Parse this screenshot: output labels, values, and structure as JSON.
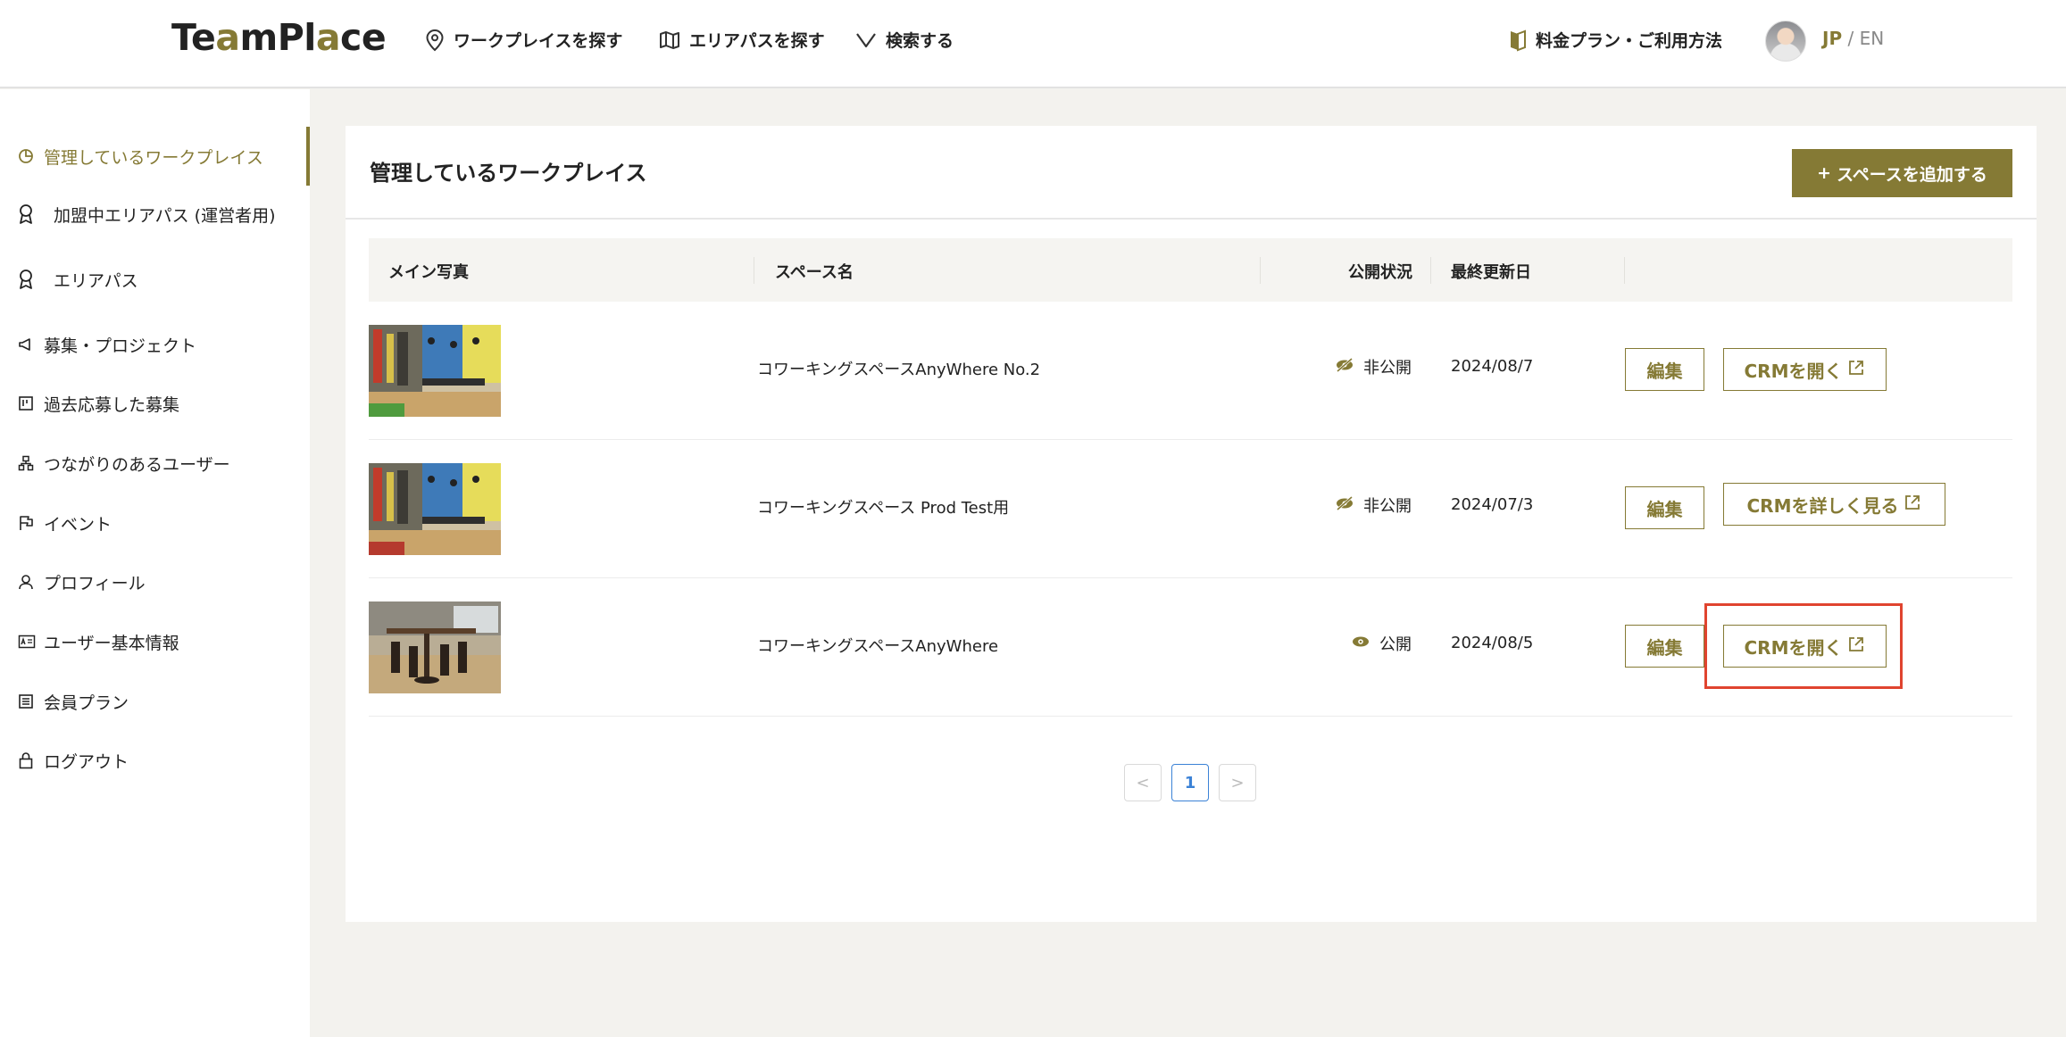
{
  "header": {
    "logo": {
      "prefix": "Te",
      "accent": "a",
      "middle": "mPl",
      "accent2": "a",
      "suffix": "ce"
    },
    "nav": [
      {
        "label": "ワークプレイスを探す",
        "icon": "map-pin-icon"
      },
      {
        "label": "エリアパスを探す",
        "icon": "map-icon"
      },
      {
        "label": "検索する",
        "icon": "chevron-down-icon"
      }
    ],
    "pricing": {
      "label": "料金プラン・ご利用方法",
      "icon": "book-icon"
    },
    "lang": {
      "jp": "JP",
      "sep": " / ",
      "en": "EN"
    }
  },
  "sidebar": {
    "items": [
      {
        "label": "管理しているワークプレイス",
        "icon": "pie-chart-icon",
        "active": true
      },
      {
        "label": "加盟中エリアパス (運営者用)",
        "icon": "award-icon"
      },
      {
        "label": "エリアパス",
        "icon": "award-icon"
      },
      {
        "label": "募集・プロジェクト",
        "icon": "megaphone-icon"
      },
      {
        "label": "過去応募した募集",
        "icon": "board-icon"
      },
      {
        "label": "つながりのあるユーザー",
        "icon": "network-icon"
      },
      {
        "label": "イベント",
        "icon": "flag-icon"
      },
      {
        "label": "プロフィール",
        "icon": "user-icon"
      },
      {
        "label": "ユーザー基本情報",
        "icon": "id-card-icon"
      },
      {
        "label": "会員プラン",
        "icon": "list-icon"
      },
      {
        "label": "ログアウト",
        "icon": "lock-icon"
      }
    ]
  },
  "main": {
    "title": "管理しているワークプレイス",
    "add_button": {
      "plus": "+",
      "label": "スペースを追加する"
    },
    "columns": [
      "メイン写真",
      "スペース名",
      "公開状況",
      "最終更新日"
    ],
    "rows": [
      {
        "name": "コワーキングスペースAnyWhere No.2",
        "status": "非公開",
        "status_icon": "eye-off-icon",
        "date": "2024/08/7",
        "edit": "編集",
        "crm": "CRMを開く"
      },
      {
        "name": "コワーキングスペース Prod Test用",
        "status": "非公開",
        "status_icon": "eye-off-icon",
        "date": "2024/07/3",
        "edit": "編集",
        "crm": "CRMを詳しく見る"
      },
      {
        "name": "コワーキングスペースAnyWhere",
        "status": "公開",
        "status_icon": "eye-icon",
        "date": "2024/08/5",
        "edit": "編集",
        "crm": "CRMを開く"
      }
    ],
    "pagination": {
      "prev": "<",
      "current": "1",
      "next": ">"
    }
  },
  "colors": {
    "accent": "#857a35",
    "highlight": "#e0442f",
    "pager_active": "#3b82d6"
  }
}
